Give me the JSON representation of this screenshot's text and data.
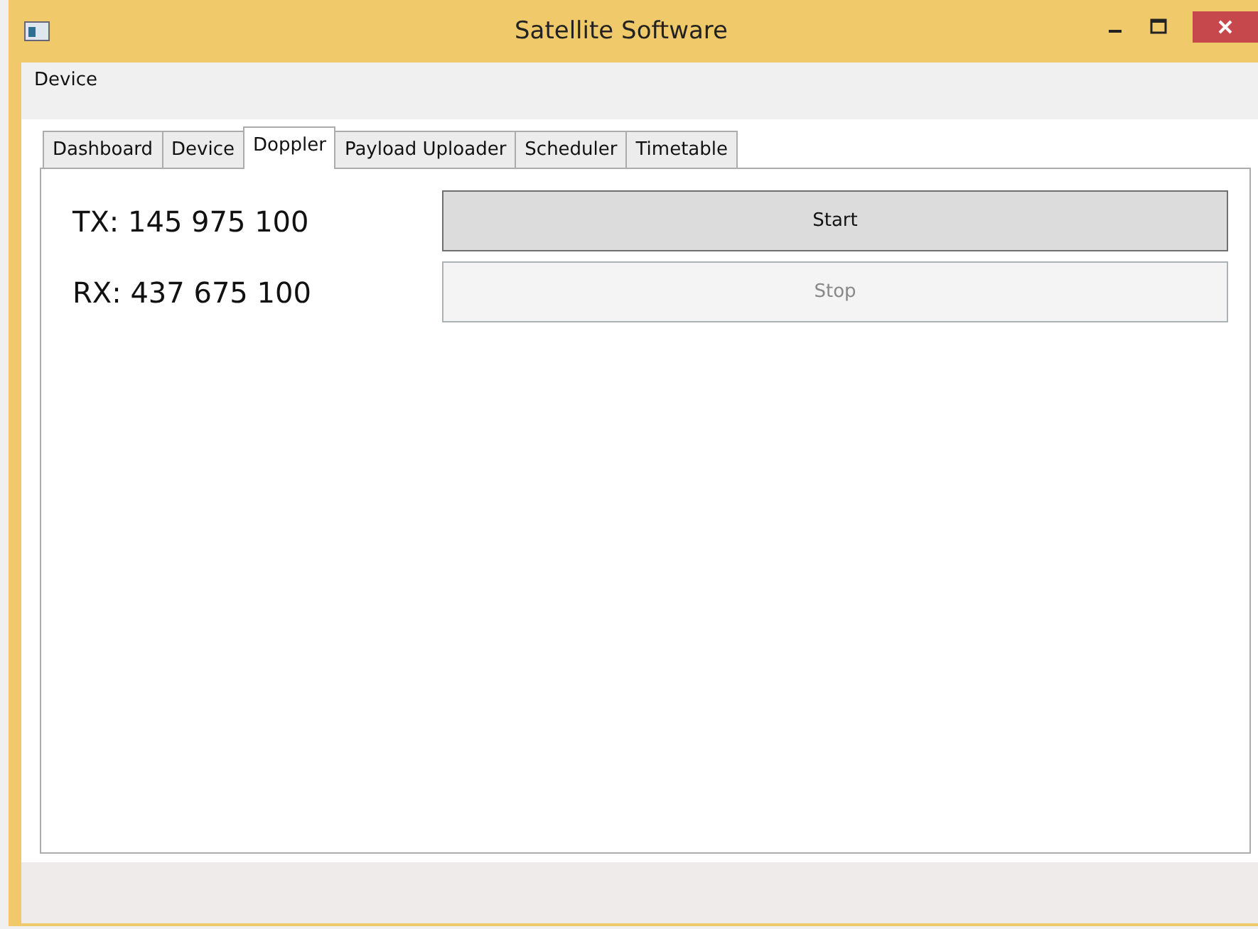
{
  "window": {
    "title": "Satellite Software"
  },
  "menu": [
    {
      "label": "Device"
    }
  ],
  "tabs": [
    {
      "label": "Dashboard",
      "selected": false
    },
    {
      "label": "Device",
      "selected": false
    },
    {
      "label": "Doppler",
      "selected": true
    },
    {
      "label": "Payload Uploader",
      "selected": false
    },
    {
      "label": "Scheduler",
      "selected": false
    },
    {
      "label": "Timetable",
      "selected": false
    }
  ],
  "rows": [
    {
      "reading": "TX: 145 975 100",
      "button": {
        "label": "Start",
        "disabled": false
      }
    },
    {
      "reading": "RX: 437 675 100",
      "button": {
        "label": "Stop",
        "disabled": true
      }
    }
  ]
}
